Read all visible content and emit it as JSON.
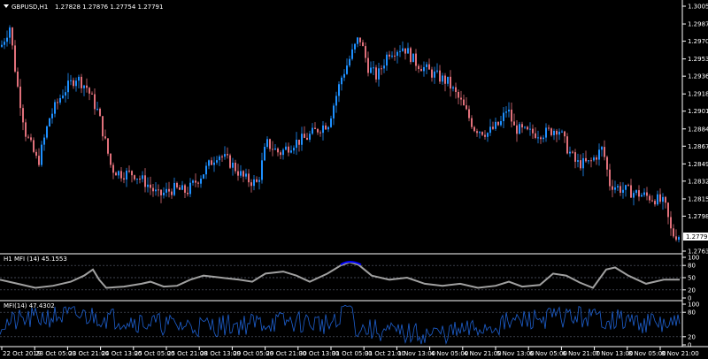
{
  "main": {
    "symbol": "GBPUSD,H1",
    "ohlc": "1.27828 1.27876 1.27754 1.27791",
    "current_price": "1.27791",
    "price_labels": [
      "1.30050",
      "1.29875",
      "1.29705",
      "1.29530",
      "1.29360",
      "1.29185",
      "1.29015",
      "1.28840",
      "1.28670",
      "1.28495",
      "1.28325",
      "1.28150",
      "1.27980",
      "1.27635"
    ],
    "price_max": 1.3005,
    "price_min": 1.27635
  },
  "indicators": [
    {
      "title": "H1 MFI (14) 45.1553",
      "levels": [
        "100",
        "80",
        "50",
        "20",
        "0"
      ]
    },
    {
      "title": "MFI(14) 47.4302",
      "levels": [
        "100",
        "80",
        "20",
        "0"
      ]
    }
  ],
  "time_labels": [
    "22 Oct 2019",
    "23 Oct 05:00",
    "23 Oct 21:00",
    "24 Oct 13:00",
    "25 Oct 05:00",
    "25 Oct 21:00",
    "28 Oct 13:00",
    "29 Oct 05:00",
    "29 Oct 21:00",
    "30 Oct 13:00",
    "31 Oct 05:00",
    "31 Oct 21:00",
    "1 Nov 13:00",
    "4 Nov 05:00",
    "4 Nov 21:00",
    "5 Nov 13:00",
    "6 Nov 05:00",
    "6 Nov 21:00",
    "7 Nov 13:00",
    "8 Nov 05:00",
    "8 Nov 21:00"
  ],
  "colors": {
    "up": "#1e90ff",
    "down": "#e0707a",
    "grid": "#5a6070",
    "mfi_line": "#a0a0a0",
    "mfi_high": "#0000ff",
    "mfi2": "#1e60d0"
  }
}
